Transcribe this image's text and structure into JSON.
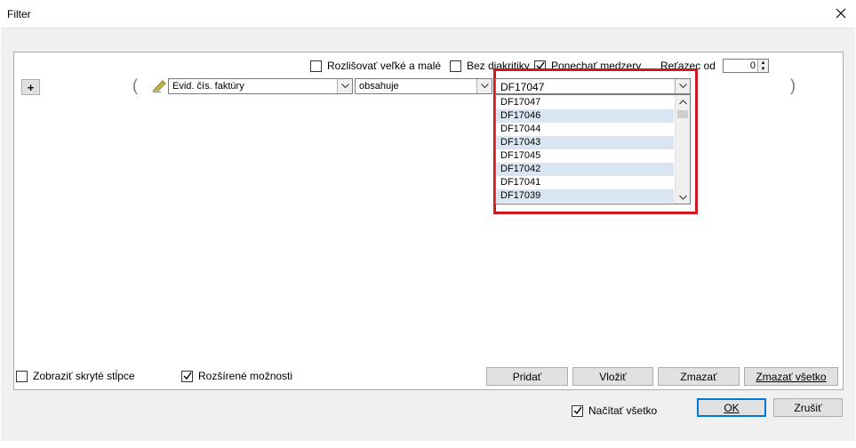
{
  "window": {
    "title": "Filter",
    "close_icon": "close-icon"
  },
  "filter": {
    "add_label": "+",
    "open_paren": "(",
    "close_paren": ")",
    "case_sensitive": {
      "label": "Rozlišovať veľké a malé",
      "checked": false
    },
    "no_diacritics": {
      "label": "Bez diakritiky",
      "checked": false
    },
    "keep_spaces": {
      "label": "Ponechať medzery",
      "checked": true
    },
    "substring_from": {
      "label": "Reťazec od",
      "value": "0"
    },
    "column": {
      "value": "Evid. čís. faktúry"
    },
    "operator": {
      "value": "obsahuje"
    },
    "value": {
      "selected": "DF17047",
      "options": [
        "DF17047",
        "DF17046",
        "DF17044",
        "DF17043",
        "DF17045",
        "DF17042",
        "DF17041",
        "DF17039"
      ]
    }
  },
  "bottom": {
    "show_hidden_columns": {
      "label": "Zobraziť skryté stĺpce",
      "checked": false
    },
    "extended_options": {
      "label": "Rozšírené možnosti",
      "checked": true
    },
    "add_button": "Pridať",
    "insert_button": "Vložiť",
    "delete_button": "Zmazať",
    "delete_all_button": "Zmazať všetko",
    "load_all": {
      "label": "Načítať všetko",
      "checked": true
    },
    "ok_button": "OK",
    "cancel_button": "Zrušiť"
  },
  "colors": {
    "highlight": "#d3171e",
    "alt_row": "#d9e5f3",
    "accent": "#0078d7"
  }
}
